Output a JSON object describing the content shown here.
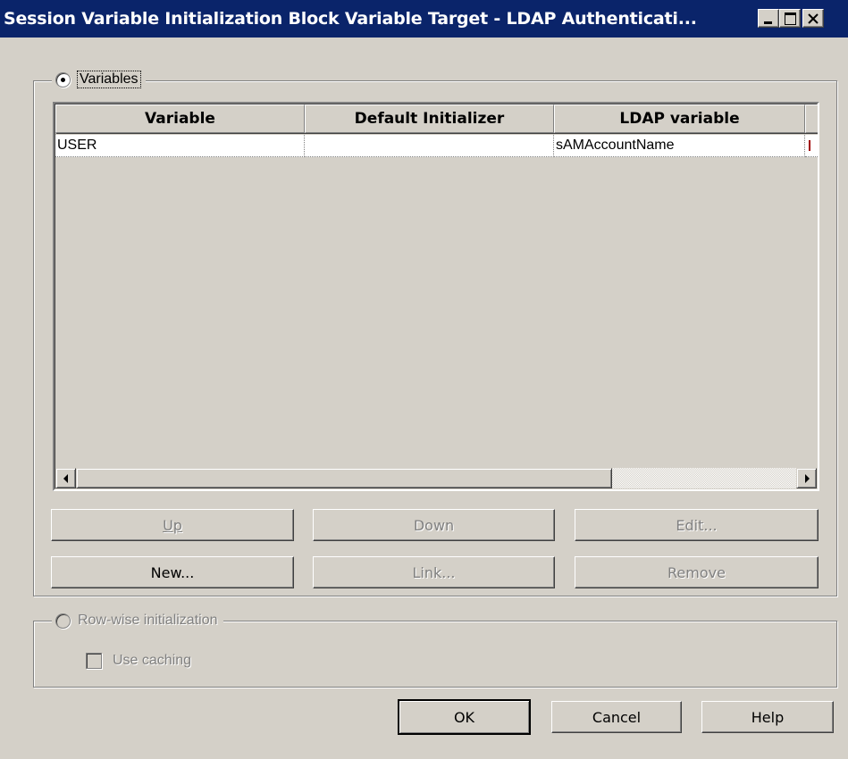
{
  "window": {
    "title": "Session Variable Initialization Block Variable Target - LDAP Authenticati...",
    "title_bar_color": "#0a246a"
  },
  "variables_group": {
    "label": "Variables",
    "selected": true
  },
  "grid": {
    "columns": [
      "Variable",
      "Default Initializer",
      "LDAP variable"
    ],
    "rows": [
      [
        "USER",
        "",
        "sAMAccountName"
      ]
    ]
  },
  "buttons_row1": {
    "up": "Up",
    "down": "Down",
    "edit": "Edit..."
  },
  "buttons_row2": {
    "new": "New...",
    "link": "Link...",
    "remove": "Remove"
  },
  "rowwise_group": {
    "label": "Row-wise initialization",
    "selected": false,
    "use_caching_label": "Use caching",
    "use_caching_checked": false
  },
  "footer": {
    "ok": "OK",
    "cancel": "Cancel",
    "help": "Help"
  }
}
